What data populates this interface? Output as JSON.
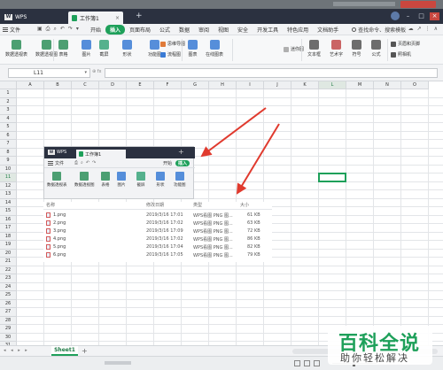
{
  "app": {
    "brand": "WPS",
    "doc_tab": "工作簿1",
    "tab_close": "×",
    "tab_plus": "+"
  },
  "menu": {
    "file": "文件",
    "quick_tools": [
      "▣",
      "⎙",
      "⌕",
      "↶",
      "↷",
      "▾"
    ],
    "items": [
      "开始",
      "插入",
      "页面布局",
      "公式",
      "数据",
      "审阅",
      "视图",
      "安全",
      "开发工具",
      "特色应用",
      "文档助手"
    ],
    "active_index": 1,
    "search": "查找命令、搜索模板",
    "right_icons": [
      "☁",
      "↗",
      "⋮",
      "∧"
    ]
  },
  "ribbon": {
    "large": [
      {
        "label": "数据透视表",
        "color": "#2f8f5b"
      },
      {
        "label": "数据透视图",
        "color": "#2f8f5b"
      },
      {
        "label": "表格",
        "color": "#2f8f5b"
      },
      {
        "label": "图片",
        "color": "#3a7bd5"
      },
      {
        "label": "截屏",
        "color": "#3aa57a"
      },
      {
        "label": "形状",
        "color": "#3a7bd5"
      },
      {
        "label": "功能图",
        "color": "#3a7bd5"
      },
      {
        "label": "图表",
        "color": "#3a7bd5"
      },
      {
        "label": "在线图表",
        "color": "#3a7bd5"
      },
      {
        "label": "文本框",
        "color": "#555"
      },
      {
        "label": "艺术字",
        "color": "#c24a4a"
      },
      {
        "label": "符号",
        "color": "#555"
      },
      {
        "label": "公式",
        "color": "#555"
      }
    ],
    "small": [
      {
        "label": "思维导图",
        "color": "#e07b39"
      },
      {
        "label": "流程图",
        "color": "#3a7bd5"
      },
      {
        "label": "迷你图",
        "color": "#b0b0b0"
      },
      {
        "label": "页眉和页脚",
        "color": "#555"
      },
      {
        "label": "照相机",
        "color": "#555"
      }
    ]
  },
  "formula": {
    "namebox": "L11",
    "fx_icons": "⊕ fx"
  },
  "grid": {
    "columns": [
      "A",
      "B",
      "C",
      "D",
      "E",
      "F",
      "G",
      "H",
      "I",
      "J",
      "K",
      "L",
      "M",
      "N",
      "O"
    ],
    "rows": [
      "1",
      "2",
      "3",
      "4",
      "5",
      "6",
      "7",
      "8",
      "9",
      "10",
      "11",
      "12",
      "13",
      "14",
      "15",
      "16",
      "17",
      "18",
      "19",
      "20",
      "21",
      "22",
      "23",
      "24",
      "25",
      "26",
      "27",
      "28",
      "29",
      "30",
      "31"
    ],
    "selected_col": "L",
    "selected_row": "11"
  },
  "embedded_screenshot": {
    "brand": "WPS",
    "doc_tab": "工作簿1",
    "file": "文件",
    "start": "开始",
    "insert": "插入",
    "buttons": [
      "数据透视表",
      "数据透视图",
      "表格",
      "图片",
      "截屏",
      "形状",
      "功能图"
    ],
    "plus": "+"
  },
  "file_list": {
    "headers": {
      "name": "名称",
      "date": "修改日期",
      "type": "类型",
      "size": "大小"
    },
    "rows": [
      {
        "name": "1.png",
        "date": "2019/3/16 17:01",
        "type": "WPS看图 PNG 图...",
        "size": "61 KB"
      },
      {
        "name": "2.png",
        "date": "2019/3/16 17:02",
        "type": "WPS看图 PNG 图...",
        "size": "63 KB"
      },
      {
        "name": "3.png",
        "date": "2019/3/16 17:09",
        "type": "WPS看图 PNG 图...",
        "size": "72 KB"
      },
      {
        "name": "4.png",
        "date": "2019/3/16 17:02",
        "type": "WPS看图 PNG 图...",
        "size": "86 KB"
      },
      {
        "name": "5.png",
        "date": "2019/3/16 17:04",
        "type": "WPS看图 PNG 图...",
        "size": "82 KB"
      },
      {
        "name": "6.png",
        "date": "2019/3/16 17:05",
        "type": "WPS看图 PNG 图...",
        "size": "79 KB"
      }
    ]
  },
  "sheets": {
    "navs": "◂ ◂ ▸ ▸",
    "active": "Sheet1",
    "add": "+"
  },
  "watermark": {
    "big": "百科全说",
    "small": "助你轻松解决"
  },
  "colors": {
    "accent": "#1ea05a",
    "arrow": "#e03a2e",
    "tabbar": "#2b3140"
  }
}
